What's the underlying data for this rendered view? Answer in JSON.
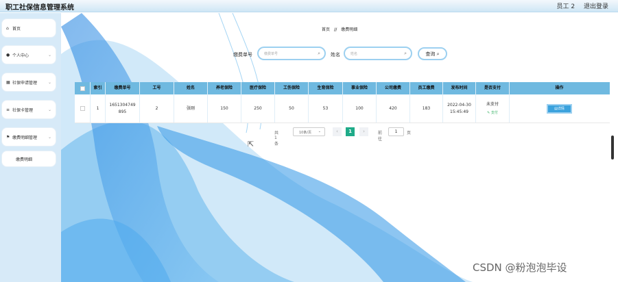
{
  "app": {
    "title": "职工社保信息管理系统"
  },
  "top_right": {
    "user": "员工 2",
    "logout": "退出登录"
  },
  "sidebar": {
    "items": [
      {
        "label": "首页",
        "icon": "home-icon"
      },
      {
        "label": "个人中心",
        "icon": "user-icon"
      },
      {
        "label": "社保申请管理",
        "icon": "grid-icon"
      },
      {
        "label": "社保卡管理",
        "icon": "list-icon"
      },
      {
        "label": "缴费明细管理",
        "icon": "flag-icon"
      }
    ],
    "subitem": "缴费明细"
  },
  "breadcrumb": {
    "home": "首页",
    "sep": "//",
    "current": "缴费明细"
  },
  "search": {
    "field1_label": "缴费单号",
    "field1_placeholder": "缴费单号",
    "field2_label": "姓名",
    "field2_placeholder": "姓名",
    "button_label": "查询"
  },
  "table": {
    "headers": [
      "索引",
      "缴费单号",
      "工号",
      "姓名",
      "养老保险",
      "医疗保险",
      "工伤保险",
      "生育保险",
      "事业保险",
      "公司缴费",
      "员工缴费",
      "发布时间",
      "是否支付",
      "操作"
    ],
    "rows": [
      {
        "index": "1",
        "order_no_line1": "1651304749",
        "order_no_line2": "895",
        "job_no": "2",
        "name": "张刚",
        "pension": "150",
        "medical": "250",
        "injury": "50",
        "maternity": "53",
        "unemployment": "100",
        "company_pay": "420",
        "employee_pay": "183",
        "date": "2022-04-30",
        "time": "15:45:49",
        "paid_status": "未支付",
        "pay_link": "支付",
        "detail_button": "详情"
      }
    ]
  },
  "pager": {
    "total": "共 1 条",
    "page_size": "10条/页",
    "current_page": "1",
    "goto_label": "前往",
    "goto_value": "1",
    "page_unit": "页"
  },
  "watermark": "CSDN @粉泡泡毕设",
  "colors": {
    "header_row": "#6fb9e0",
    "sidebar": "#d7eaf8",
    "accent": "#3ba2dd",
    "pager_active": "#1fab89"
  }
}
